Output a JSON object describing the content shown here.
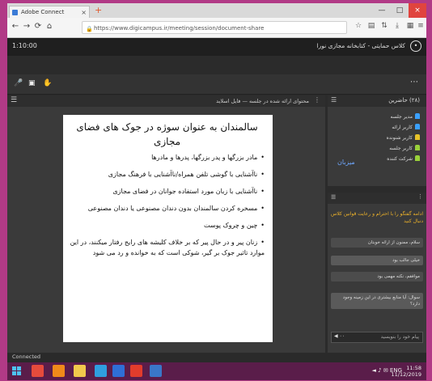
{
  "browser": {
    "tab_title": "Adobe Connect",
    "url": "https://www.digicampus.ir/meeting/session/document-share",
    "controls": {
      "back": "←",
      "forward": "→",
      "reload": "⟳",
      "home": "⌂"
    }
  },
  "app": {
    "time": "1:10:00",
    "meeting_title": "کلاس حمایتی - کتابخانه مجازی نورا",
    "user_icon": "user-icon"
  },
  "toolbar": {
    "items": [
      "microphone-icon",
      "screen-icon",
      "hand-icon"
    ]
  },
  "share_pod": {
    "title": "محتوای ارائه شده در جلسه — فایل اسلاید",
    "slide": {
      "title": "سالمندان به عنوان سوژه در جوک های فضای مجازی",
      "bullets": [
        "مادر بزرگها و پدر بزرگها، پدرها و مادرها",
        "ناآشنایی با گوشی تلفن همراه/ناآشنایی با فرهنگ مجازی",
        "ناآشنایی با زبان مورد استفاده جوانان در فضای مجازی",
        "مسخره کردن سالمندان بدون دندان مصنوعی یا دندان مصنوعی",
        "چین و چروک پوست",
        "زنان پیر و در حال پیر که بر خلاف کلیشه های رایج رفتار میکنند، در این موارد تاثیر جوک بر گیر، شوکی است که به خوانده و رد می شود"
      ]
    }
  },
  "attendees": {
    "count": "(۲۸) حاضرین",
    "host_label": "میزبان",
    "items": [
      {
        "name": "مدیر جلسه",
        "color": "#3aa0ff"
      },
      {
        "name": "کاربر ارائه",
        "color": "#3aa0ff"
      },
      {
        "name": "کاربر شنونده",
        "color": "#e6c229"
      },
      {
        "name": "کاربر جلسه",
        "color": "#9ad13a"
      },
      {
        "name": "شرکت کننده",
        "color": "#9ad13a"
      }
    ]
  },
  "chat": {
    "notice": "ادامه گفتگو را با احترام و رعایت قوانین کلاس دنبال کنید",
    "messages": [
      {
        "text": "سلام، ممنون از ارائه خوبتان"
      },
      {
        "text": "خیلی جالب بود"
      },
      {
        "text": "موافقم، نکته مهمی بود"
      },
      {
        "text": "سوال: آیا منابع بیشتری در این زمینه وجود دارد؟"
      }
    ],
    "input_placeholder": "پیام خود را بنویسید",
    "audio_label": "◀ ۰۰"
  },
  "status": {
    "text": "Connected"
  },
  "taskbar": {
    "apps": [
      {
        "name": "start-icon",
        "color": "#4ec3f0"
      },
      {
        "name": "chrome-icon",
        "color": "#e64b3c"
      },
      {
        "name": "firefox-icon",
        "color": "#f08a1a"
      },
      {
        "name": "explorer-icon",
        "color": "#f2c94c"
      },
      {
        "name": "media-icon",
        "color": "#2f9ee0"
      },
      {
        "name": "word-icon",
        "color": "#2f6fd6"
      },
      {
        "name": "adobe-icon",
        "color": "#e23c2c"
      },
      {
        "name": "photoshop-icon",
        "color": "#3a77c8"
      }
    ],
    "tray": "◄ ♪ ✉ ENG",
    "time": "11:58",
    "date": "11/12/2019"
  }
}
